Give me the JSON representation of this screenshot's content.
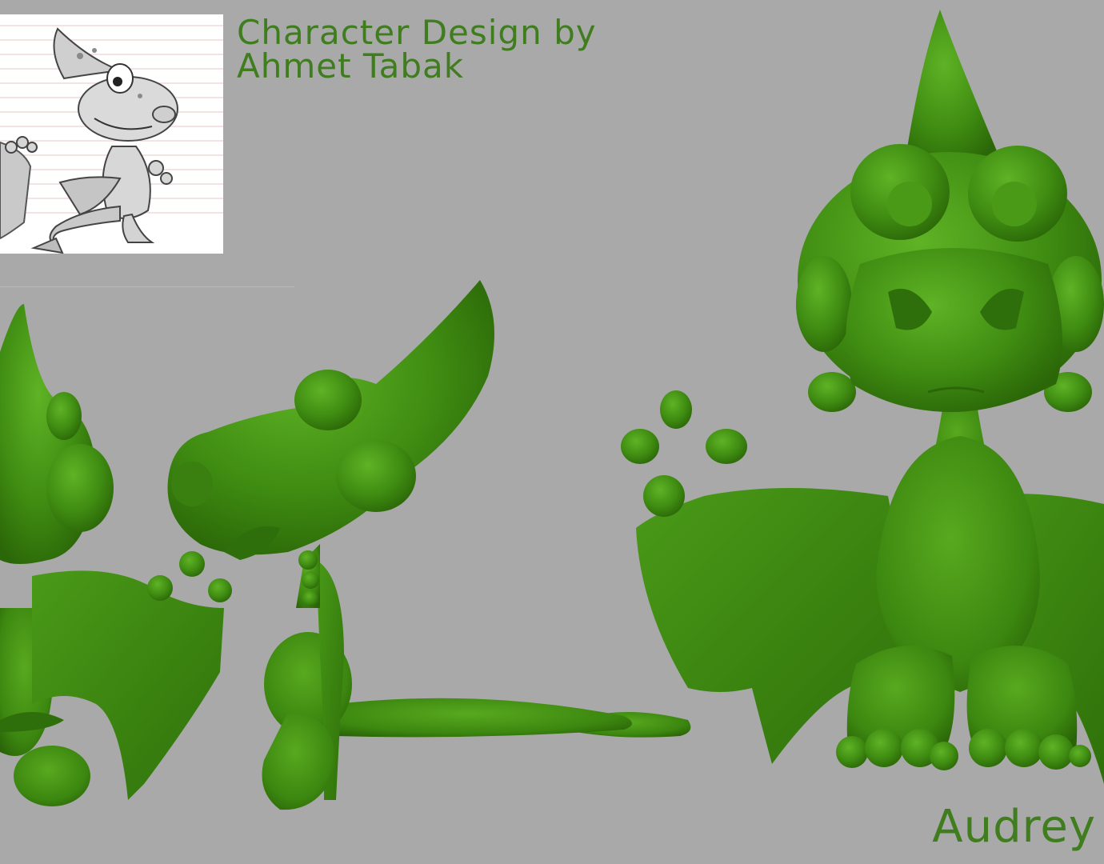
{
  "credit": {
    "line1": "Character Design by",
    "line2": "Ahmet Tabak"
  },
  "character": {
    "name": "Audrey"
  },
  "colors": {
    "background": "#a9a9a9",
    "model_green": "#3f8c12",
    "model_highlight": "#5fb325",
    "model_shadow": "#2b6708",
    "text_green": "#3f7d1f"
  }
}
